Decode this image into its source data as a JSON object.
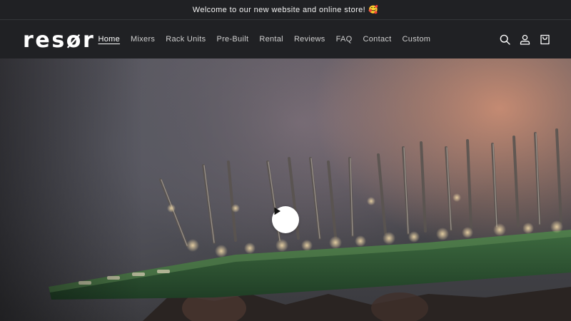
{
  "announcement": {
    "text": "Welcome to our new website and online store!",
    "emoji": "🥰"
  },
  "header": {
    "logo_text": "resør",
    "nav": [
      {
        "label": "Home",
        "active": true
      },
      {
        "label": "Mixers",
        "active": false
      },
      {
        "label": "Rack Units",
        "active": false
      },
      {
        "label": "Pre-Built",
        "active": false
      },
      {
        "label": "Rental",
        "active": false
      },
      {
        "label": "Reviews",
        "active": false
      },
      {
        "label": "FAQ",
        "active": false
      },
      {
        "label": "Contact",
        "active": false
      },
      {
        "label": "Custom",
        "active": false
      }
    ],
    "icons": [
      "search-icon",
      "account-icon",
      "cart-icon"
    ]
  },
  "hero": {
    "type": "video",
    "play_icon": "play-icon"
  },
  "colors": {
    "background": "#202124",
    "text": "#ffffff",
    "nav_text": "#cfcfcf",
    "board_green": "#2f5a35"
  }
}
